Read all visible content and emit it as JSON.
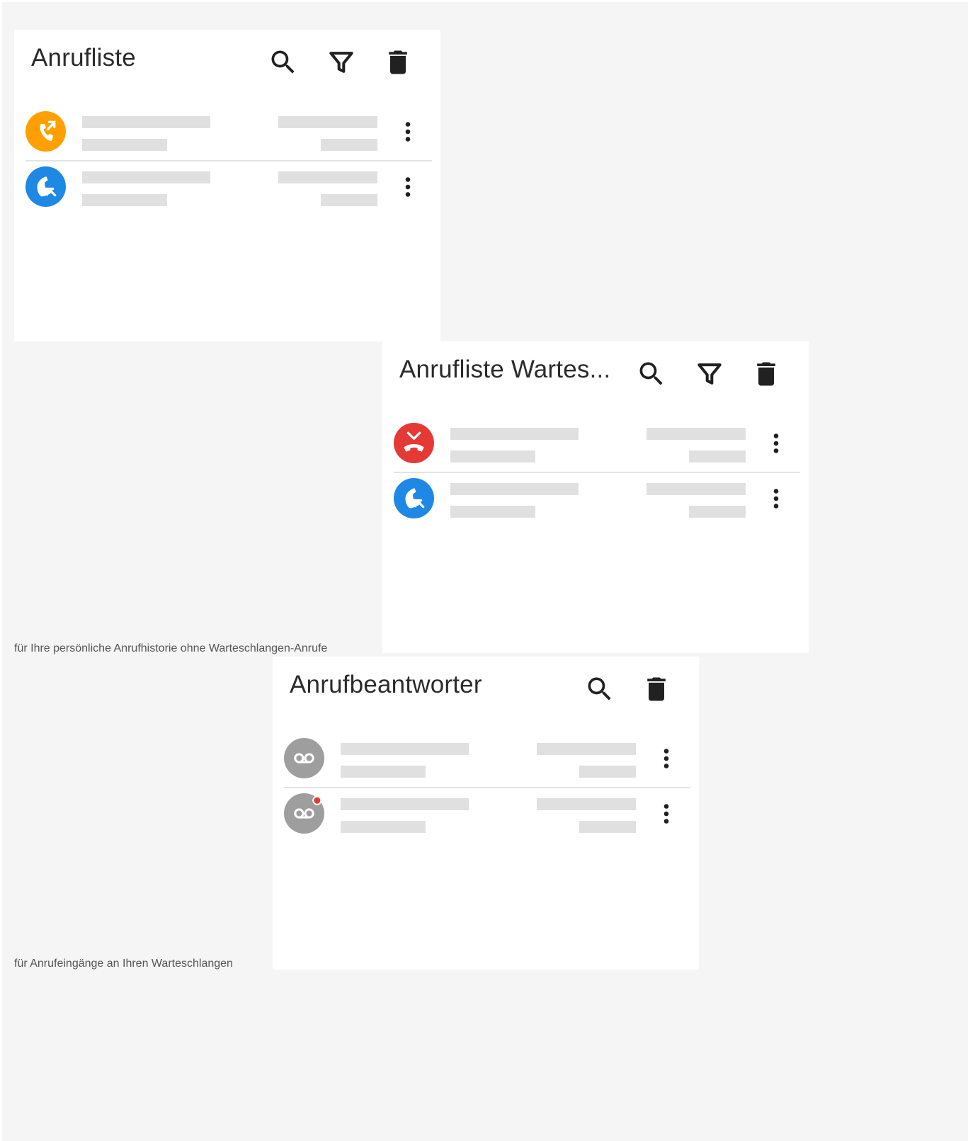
{
  "panels": [
    {
      "title": "Anrufliste",
      "toolbar": [
        "search-icon",
        "filter-icon",
        "delete-icon"
      ],
      "rows": [
        {
          "icon": "outgoing-call-icon",
          "color": "#ffa000"
        },
        {
          "icon": "incoming-call-icon",
          "color": "#1e88e5"
        }
      ]
    },
    {
      "title": "Anrufliste Wartes...",
      "toolbar": [
        "search-icon",
        "filter-icon",
        "delete-icon"
      ],
      "rows": [
        {
          "icon": "missed-call-icon",
          "color": "#e53935"
        },
        {
          "icon": "incoming-call-icon",
          "color": "#1e88e5"
        }
      ]
    },
    {
      "title": "Anrufbeantworter",
      "toolbar": [
        "search-icon",
        "delete-icon"
      ],
      "rows": [
        {
          "icon": "voicemail-icon",
          "color": "#9e9e9e",
          "unread": false
        },
        {
          "icon": "voicemail-icon",
          "color": "#9e9e9e",
          "unread": true,
          "badge_color": "#e53935"
        }
      ]
    }
  ],
  "captions": {
    "personal": "für Ihre persönliche Anrufhistorie ohne Warteschlangen-Anrufe",
    "queues": "für Anrufeingänge an Ihren Warteschlangen"
  },
  "colors": {
    "background": "#f5f5f5",
    "panel": "#ffffff",
    "skeleton": "#e0e0e0",
    "icon": "#212121"
  }
}
